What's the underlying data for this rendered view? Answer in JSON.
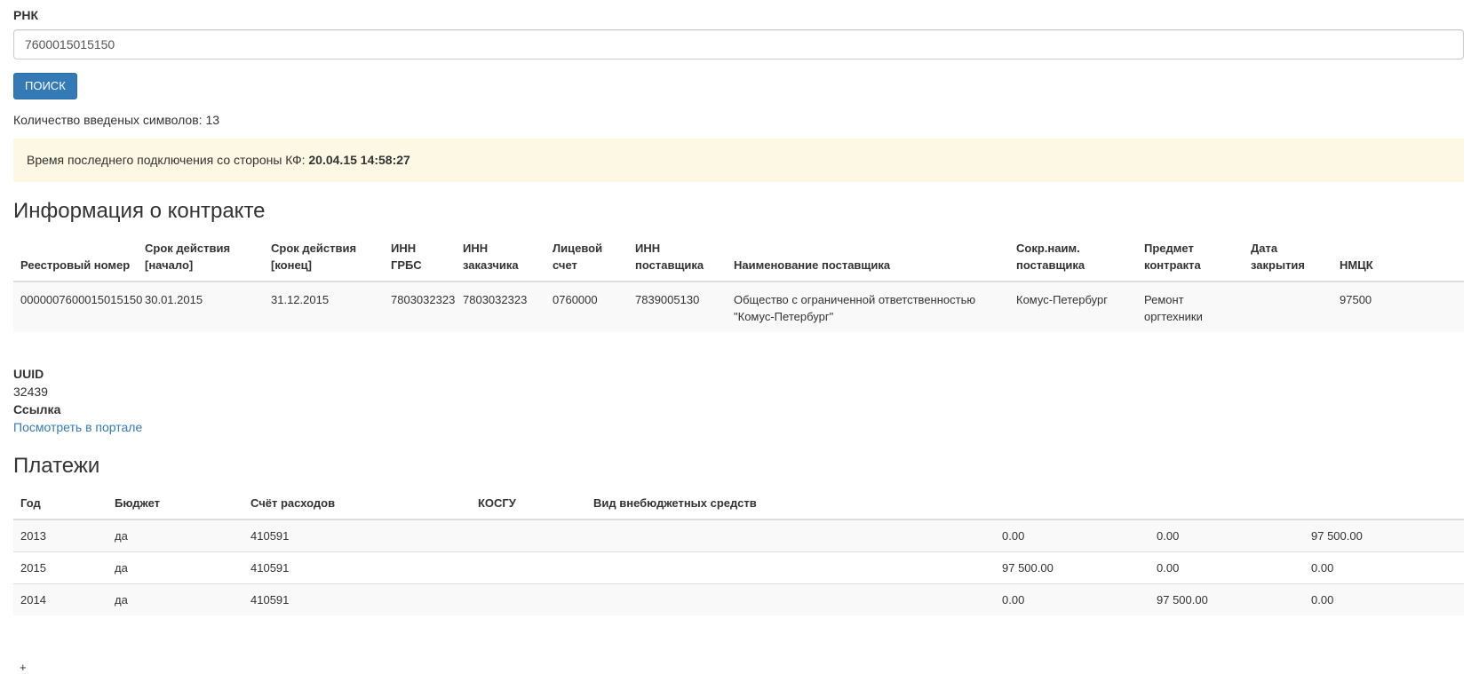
{
  "search": {
    "label": "РНК",
    "value": "7600015015150",
    "button_label": "ПОИСК",
    "counter_text": "Количество введеных символов: 13"
  },
  "alert": {
    "text": "Время последнего подключения со стороны КФ:",
    "timestamp": "20.04.15 14:58:27"
  },
  "contract": {
    "heading": "Информация о контракте",
    "columns": [
      "Реестровый номер",
      "Срок действия [начало]",
      "Срок действия [конец]",
      "ИНН ГРБС",
      "ИНН заказчика",
      "Лицевой счет",
      "ИНН поставщика",
      "Наименование поставщика",
      "Сокр.наим. поставщика",
      "Предмет контракта",
      "Дата закрытия",
      "НМЦК"
    ],
    "row": [
      "0000007600015015150",
      "30.01.2015",
      "31.12.2015",
      "7803032323",
      "7803032323",
      "0760000",
      "7839005130",
      "Общество с ограниченной ответственностью \"Комус-Петербург\"",
      "Комус-Петербург",
      "Ремонт оргтехники",
      "",
      "97500"
    ]
  },
  "meta": {
    "uuid_label": "UUID",
    "uuid_value": "32439",
    "link_label": "Ссылка",
    "link_text": "Посмотреть в портале"
  },
  "payments": {
    "heading": "Платежи",
    "columns": [
      "Год",
      "Бюджет",
      "Счёт расходов",
      "КОСГУ",
      "Вид внебюджетных средств",
      "",
      "",
      ""
    ],
    "rows": [
      [
        "2013",
        "да",
        "410591",
        "",
        "",
        "0.00",
        "0.00",
        "97 500.00"
      ],
      [
        "2015",
        "да",
        "410591",
        "",
        "",
        "97 500.00",
        "0.00",
        "0.00"
      ],
      [
        "2014",
        "да",
        "410591",
        "",
        "",
        "0.00",
        "97 500.00",
        "0.00"
      ]
    ]
  },
  "footer_glyph": "+"
}
